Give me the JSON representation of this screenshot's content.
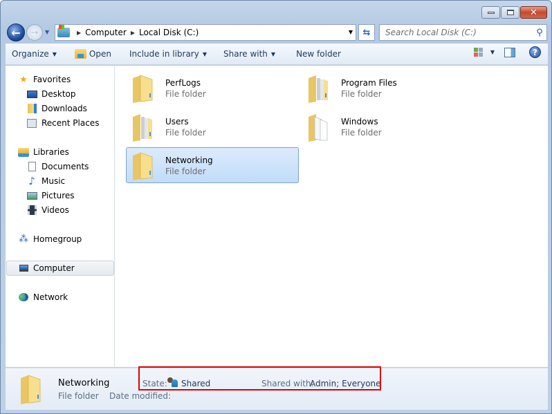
{
  "window": {
    "caption_buttons": [
      "minimize",
      "maximize",
      "close"
    ]
  },
  "navigation": {
    "back_icon": "back-arrow-icon",
    "forward_icon": "forward-arrow-icon",
    "address_icon": "local-disk-icon",
    "breadcrumb": [
      "Computer",
      "Local Disk (C:)"
    ],
    "search_placeholder": "Search Local Disk (C:)"
  },
  "toolbar": {
    "organize": "Organize",
    "open": "Open",
    "include_in_library": "Include in library",
    "share_with": "Share with",
    "new_folder": "New folder"
  },
  "sidebar": {
    "favorites": {
      "label": "Favorites",
      "items": [
        "Desktop",
        "Downloads",
        "Recent Places"
      ]
    },
    "libraries": {
      "label": "Libraries",
      "items": [
        "Documents",
        "Music",
        "Pictures",
        "Videos"
      ]
    },
    "homegroup": "Homegroup",
    "computer": "Computer",
    "network": "Network",
    "selected": "Computer"
  },
  "files": [
    {
      "name": "PerfLogs",
      "type": "File folder",
      "variant": "empty"
    },
    {
      "name": "Program Files",
      "type": "File folder",
      "variant": "docs"
    },
    {
      "name": "Users",
      "type": "File folder",
      "variant": "docs"
    },
    {
      "name": "Windows",
      "type": "File folder",
      "variant": "white"
    },
    {
      "name": "Networking",
      "type": "File folder",
      "variant": "empty",
      "selected": true
    }
  ],
  "details": {
    "name": "Networking",
    "type": "File folder",
    "state_label": "State:",
    "state_value": "Shared",
    "shared_with_label": "Shared with:",
    "shared_with_value": "Admin; Everyone",
    "date_modified_label": "Date modified:"
  },
  "colors": {
    "highlight_box": "#e00000",
    "selection_bg": "#cce4fb",
    "selection_border": "#7da2ce"
  }
}
